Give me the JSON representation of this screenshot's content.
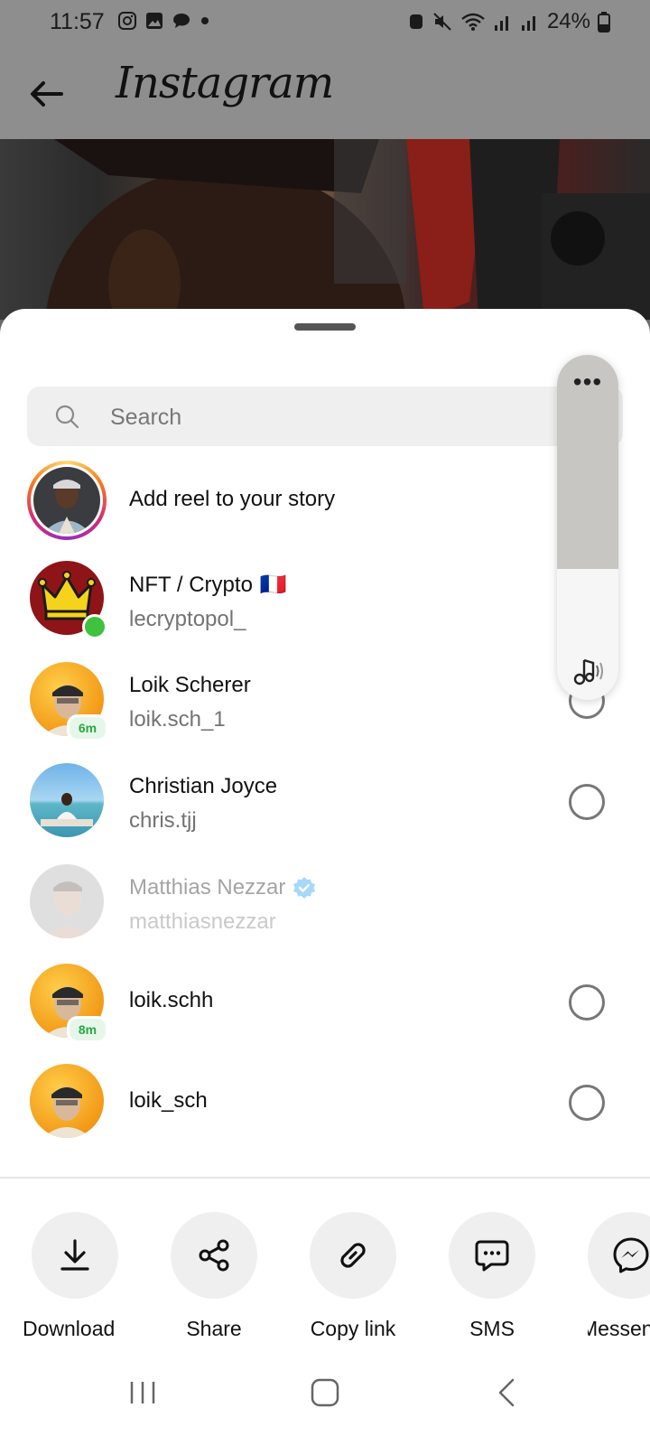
{
  "status_bar": {
    "time": "11:57",
    "battery": "24%"
  },
  "app_bar": {
    "title": "Instagram"
  },
  "share_sheet": {
    "search_placeholder": "Search",
    "story_row": {
      "label": "Add reel to your story"
    },
    "contacts": [
      {
        "name": "NFT / Crypto",
        "flag": "🇫🇷",
        "username": "lecryptopol_",
        "online": true
      },
      {
        "name": "Loik Scherer",
        "username": "loik.sch_1",
        "active_badge": "6m"
      },
      {
        "name": "Christian Joyce",
        "username": "chris.tjj"
      },
      {
        "name": "Matthias Nezzar",
        "username": "matthiasnezzar",
        "verified": true,
        "disabled": true
      },
      {
        "name": "loik.schh",
        "active_badge": "8m"
      },
      {
        "name": "loik_sch"
      }
    ],
    "actions": [
      {
        "label": "Download",
        "icon": "download-icon"
      },
      {
        "label": "Share",
        "icon": "share-icon"
      },
      {
        "label": "Copy link",
        "icon": "link-icon"
      },
      {
        "label": "SMS",
        "icon": "sms-icon"
      },
      {
        "label": "Messenger",
        "icon": "messenger-icon"
      }
    ]
  },
  "floating_widget": {
    "menu": "•••",
    "icon": "music-note-icon"
  }
}
